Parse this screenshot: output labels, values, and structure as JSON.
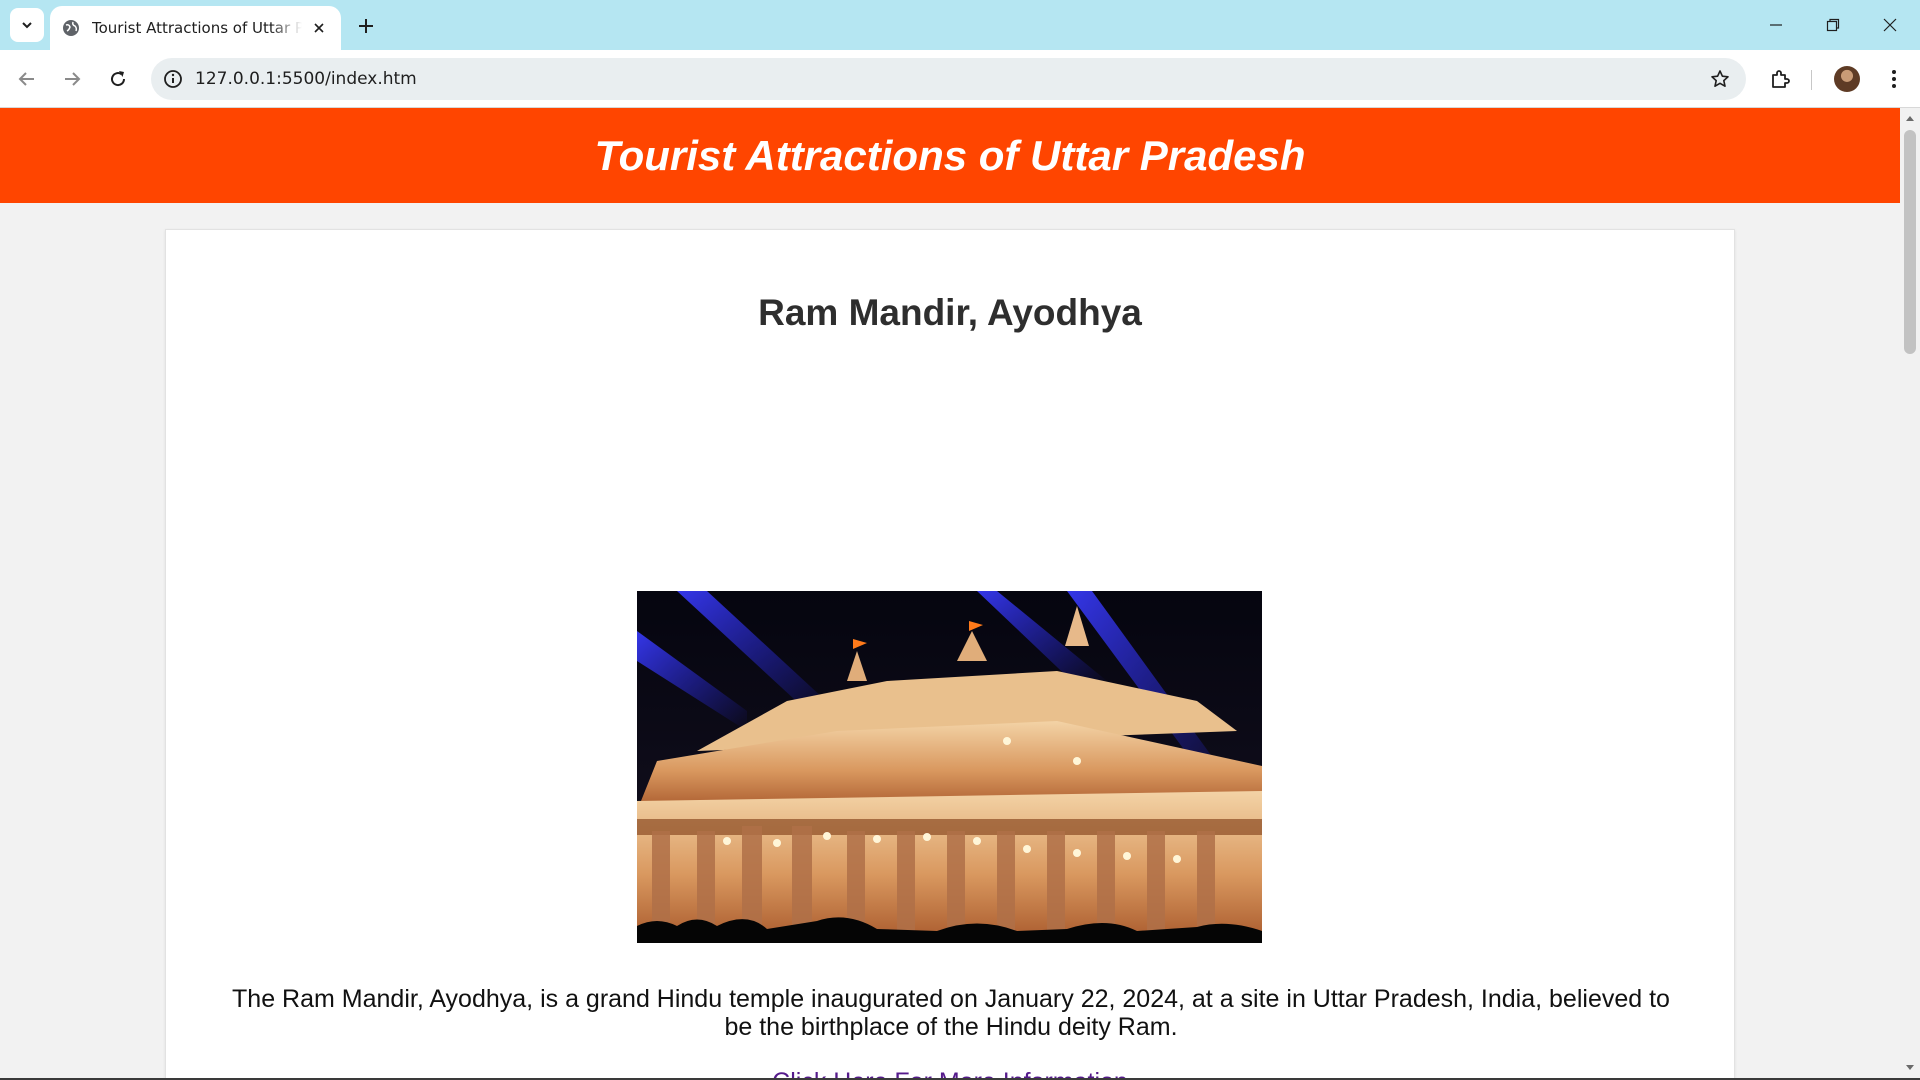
{
  "browser": {
    "tab_title": "Tourist Attractions of Uttar Pradesh",
    "url": "127.0.0.1:5500/index.htm",
    "icons": {
      "tab_list": "chevron-down-icon",
      "favicon": "globe-icon",
      "close": "close-icon",
      "new_tab": "plus-icon",
      "back": "arrow-left-icon",
      "forward": "arrow-right-icon",
      "reload": "reload-icon",
      "site_info": "info-icon",
      "bookmark": "star-icon",
      "extensions": "puzzle-icon",
      "profile": "avatar",
      "menu": "kebab-menu-icon",
      "minimize": "minimize-icon",
      "restore": "restore-icon",
      "window_close": "close-icon"
    }
  },
  "page": {
    "header_title": "Tourist Attractions of Uttar Pradesh",
    "header_color": "#ff4500",
    "card": {
      "title": "Ram Mandir, Ayodhya",
      "description": "The Ram Mandir, Ayodhya, is a grand Hindu temple inaugurated on January 22, 2024, at a site in Uttar Pradesh, India, believed to be the birthplace of the Hindu deity Ram.",
      "link_text": "Click Here For More Information"
    }
  }
}
